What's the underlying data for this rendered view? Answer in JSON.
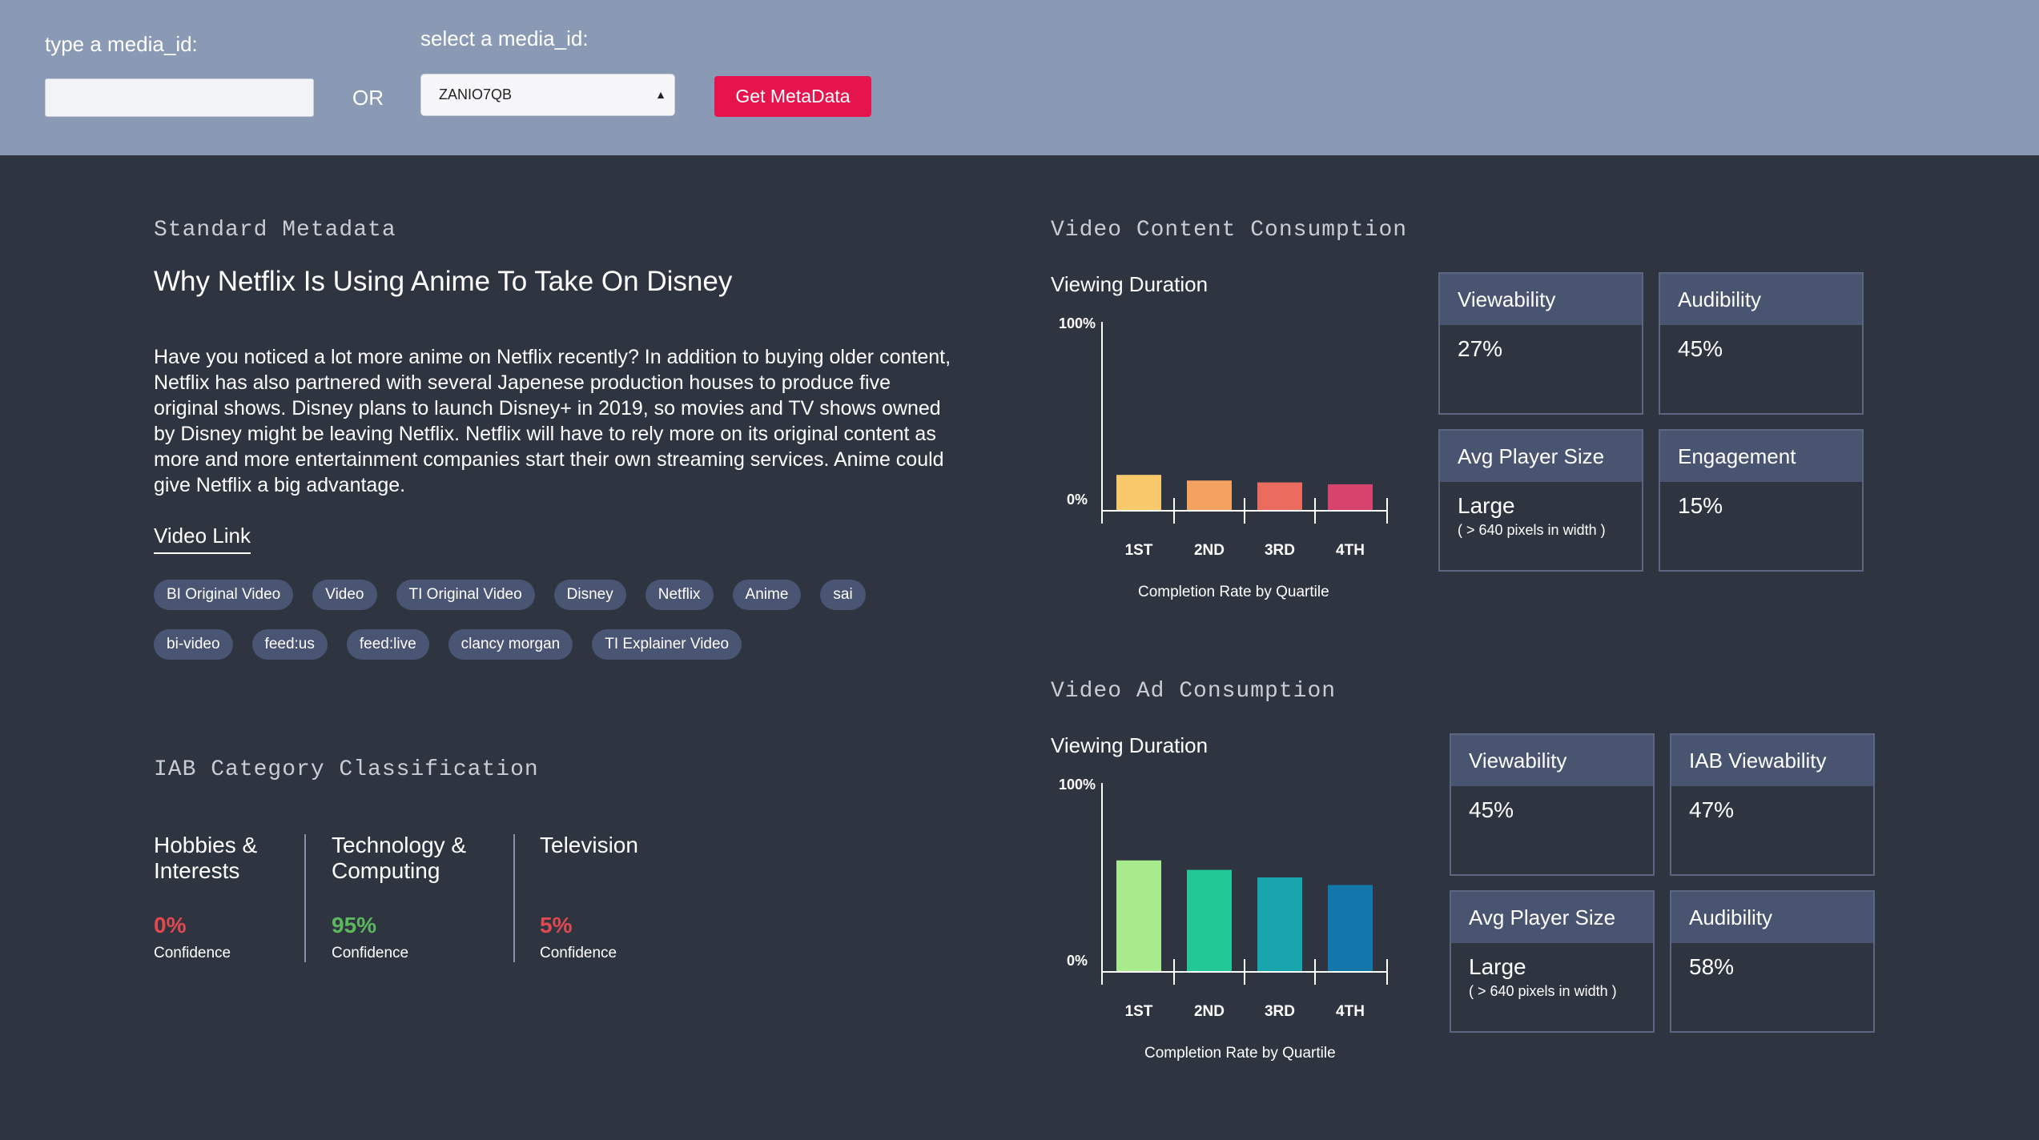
{
  "search": {
    "type_label": "type a media_id:",
    "type_value": "",
    "or_label": "OR",
    "select_label": "select a media_id:",
    "select_value": "ZANIO7QB",
    "button_label": "Get MetaData"
  },
  "standard": {
    "section_title": "Standard Metadata",
    "title": "Why Netflix Is Using Anime To Take On Disney",
    "description": "Have you noticed a lot more anime on Netflix recently? In addition to buying older content, Netflix has also partnered with several Japenese production houses to produce five original shows. Disney plans to launch Disney+ in 2019, so movies and TV shows owned by Disney might be leaving Netflix. Netflix will have to rely more on its original content as more and more entertainment companies start their own streaming services. Anime could give Netflix a big advantage.",
    "video_link": "Video Link",
    "tags_row1": [
      "BI Original Video",
      "Video",
      "TI Original Video",
      "Disney",
      "Netflix",
      "Anime",
      "sai"
    ],
    "tags_row2": [
      "bi-video",
      "feed:us",
      "feed:live",
      "clancy morgan",
      "TI Explainer Video"
    ]
  },
  "iab": {
    "section_title": "IAB Category Classification",
    "categories": [
      {
        "name_l1": "Hobbies &",
        "name_l2": "Interests",
        "confidence": "0%",
        "color": "#e0494f",
        "conf_label": "Confidence"
      },
      {
        "name_l1": "Technology &",
        "name_l2": "Computing",
        "confidence": "95%",
        "color": "#5cb85c",
        "conf_label": "Confidence"
      },
      {
        "name_l1": "Television",
        "name_l2": "",
        "confidence": "5%",
        "color": "#e0494f",
        "conf_label": "Confidence"
      }
    ]
  },
  "content": {
    "section_title": "Video Content Consumption",
    "chart_label": "Viewing Duration",
    "caption": "Completion Rate by Quartile",
    "metrics": [
      {
        "label": "Viewability",
        "value": "27%",
        "sub": ""
      },
      {
        "label": "Audibility",
        "value": "45%",
        "sub": ""
      },
      {
        "label": "Avg Player Size",
        "value": "Large",
        "sub": "( > 640 pixels in width )"
      },
      {
        "label": "Engagement",
        "value": "15%",
        "sub": ""
      }
    ]
  },
  "ad": {
    "section_title": "Video Ad Consumption",
    "chart_label": "Viewing Duration",
    "caption": "Completion Rate by Quartile",
    "metrics": [
      {
        "label": "Viewability",
        "value": "45%",
        "sub": ""
      },
      {
        "label": "IAB Viewability",
        "value": "47%",
        "sub": ""
      },
      {
        "label": "Avg Player Size",
        "value": "Large",
        "sub": "( > 640 pixels in width )"
      },
      {
        "label": "Audibility",
        "value": "58%",
        "sub": ""
      }
    ]
  },
  "chart_data": [
    {
      "type": "bar",
      "categories": [
        "1ST",
        "2ND",
        "3RD",
        "4TH"
      ],
      "values": [
        19,
        16,
        15,
        14
      ],
      "colors": [
        "#f7c96a",
        "#f4a261",
        "#ea6c5c",
        "#d6446d"
      ],
      "ylabel_top": "100%",
      "ylabel_bottom": "0%",
      "ylim": [
        0,
        100
      ],
      "xlabel": "Completion Rate by Quartile"
    },
    {
      "type": "bar",
      "categories": [
        "1ST",
        "2ND",
        "3RD",
        "4TH"
      ],
      "values": [
        59,
        54,
        50,
        46
      ],
      "colors": [
        "#a8eb8c",
        "#22c997",
        "#18a5ad",
        "#1377ab"
      ],
      "ylabel_top": "100%",
      "ylabel_bottom": "0%",
      "ylim": [
        0,
        100
      ],
      "xlabel": "Completion Rate by Quartile"
    }
  ]
}
